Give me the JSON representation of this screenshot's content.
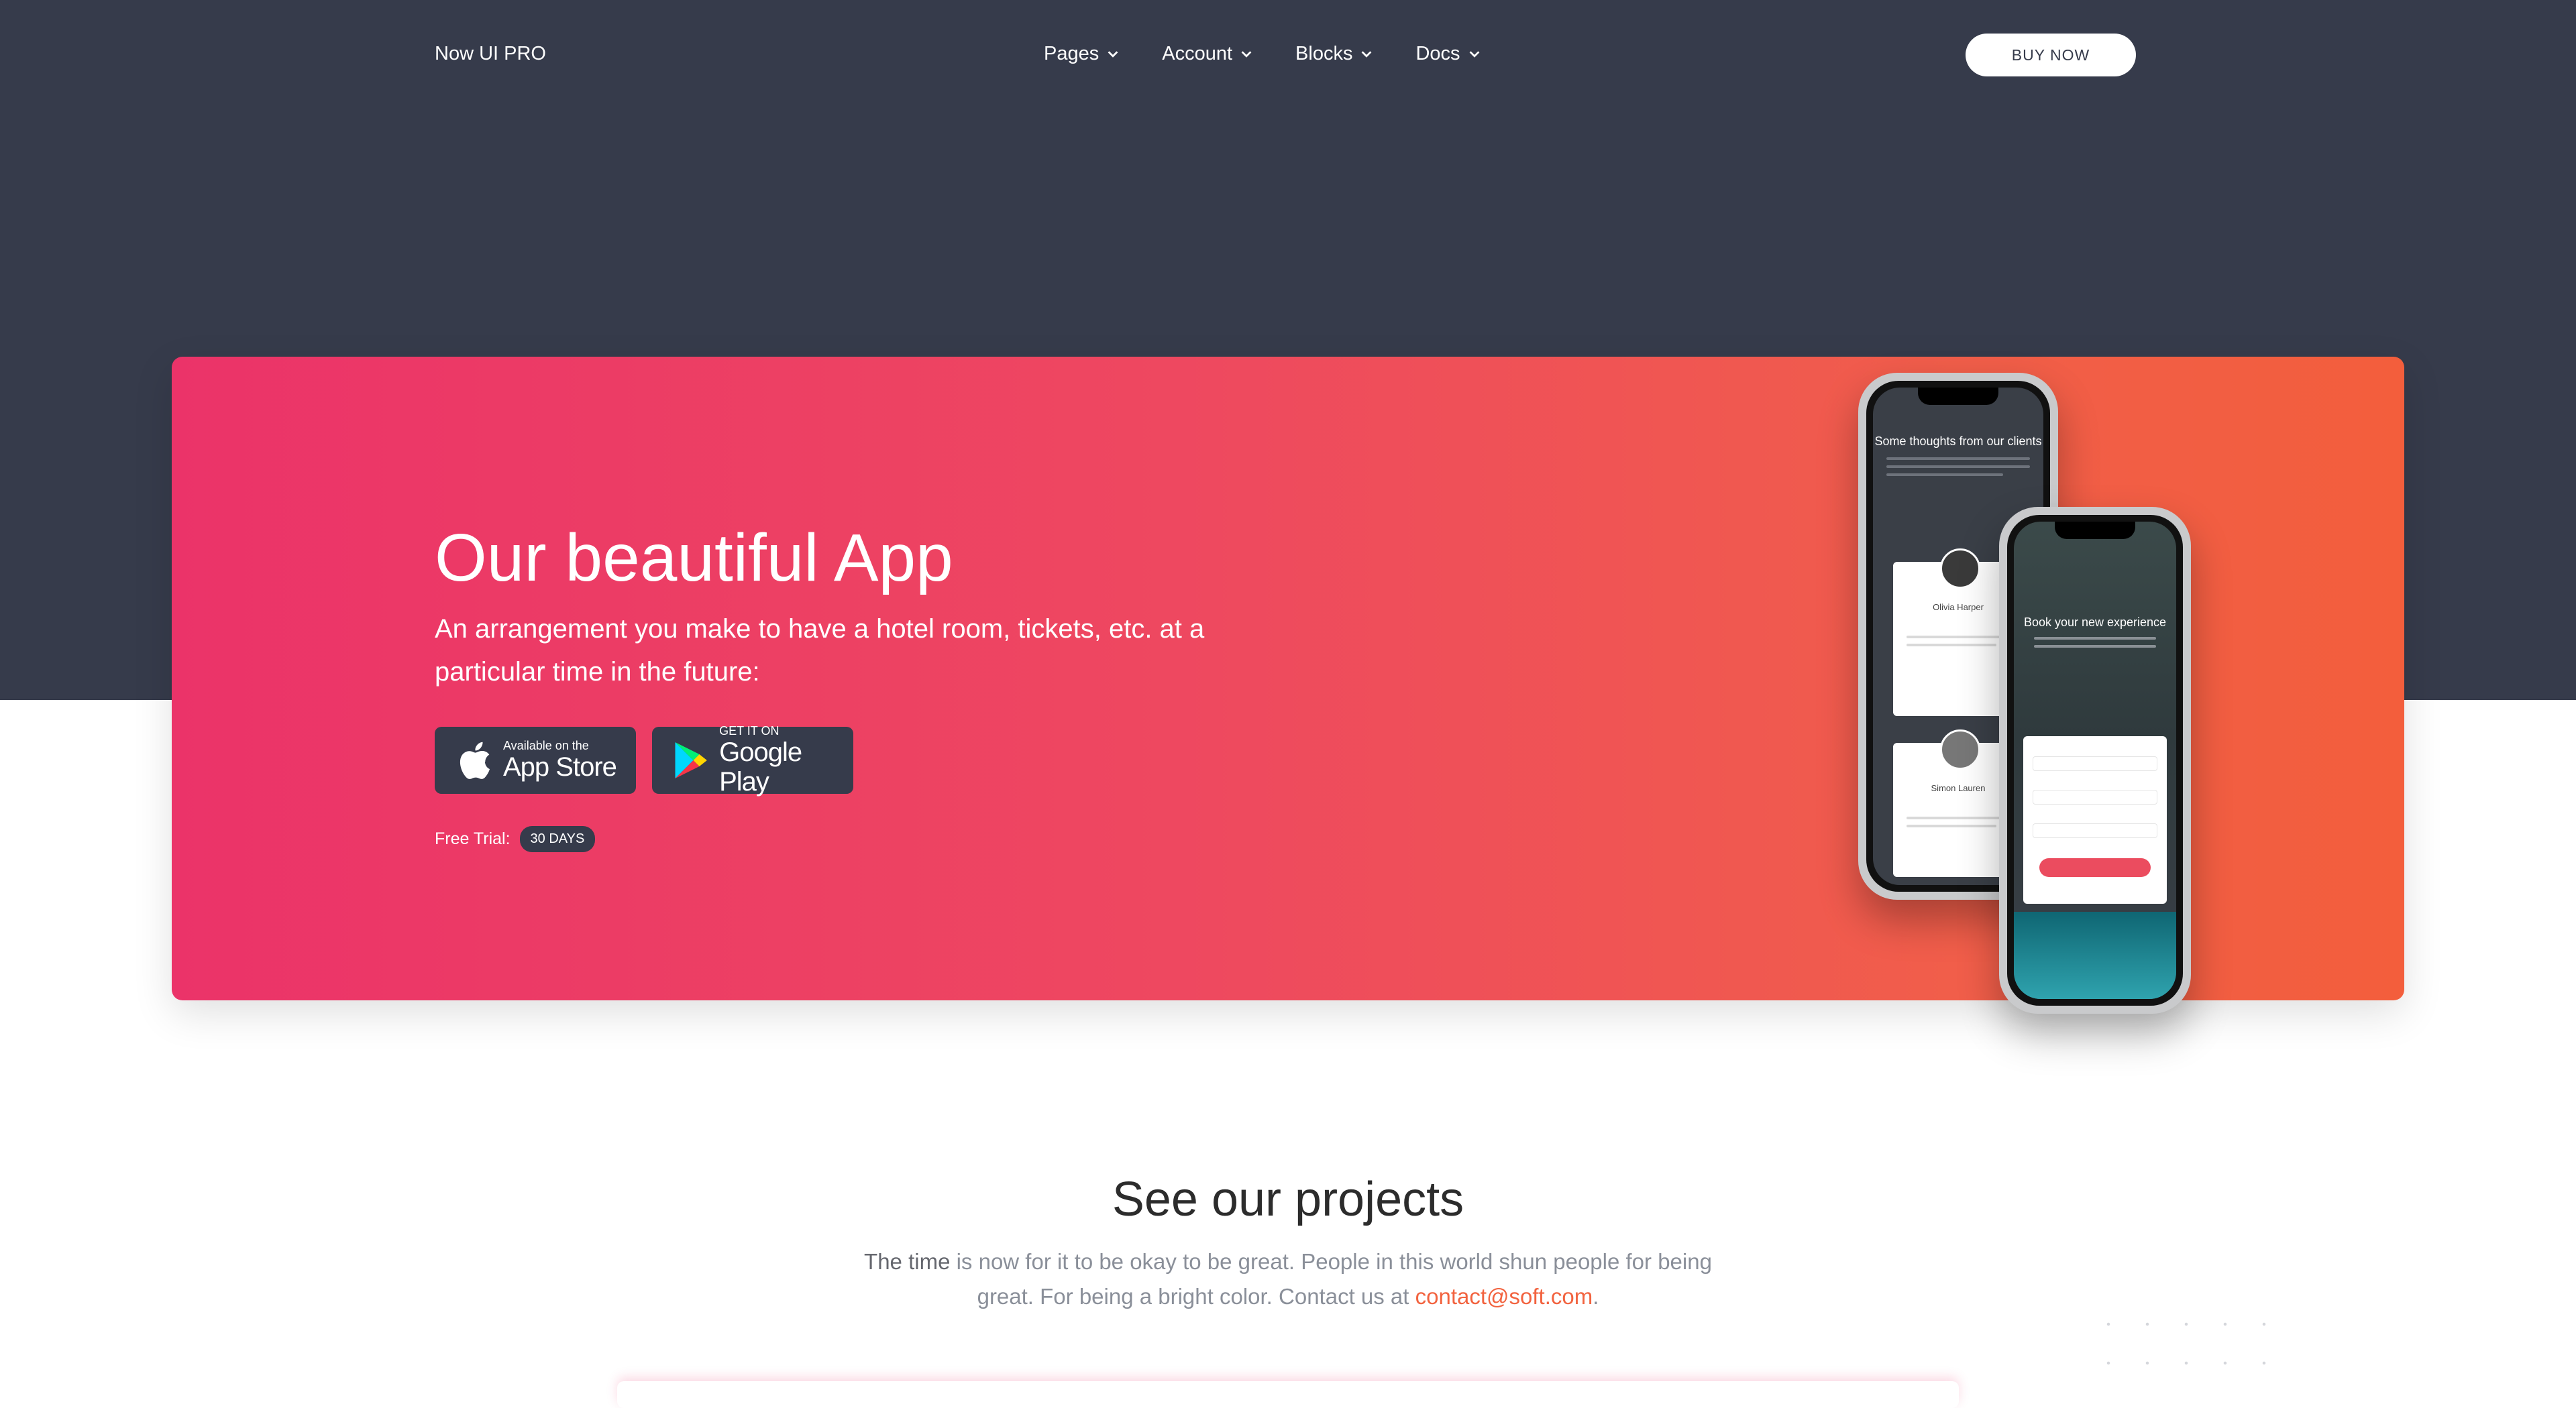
{
  "navbar": {
    "brand": "Now UI PRO",
    "items": [
      {
        "label": "Pages"
      },
      {
        "label": "Account"
      },
      {
        "label": "Blocks"
      },
      {
        "label": "Docs"
      }
    ],
    "cta": "BUY NOW"
  },
  "hero": {
    "title": "Our beautiful App",
    "subtitle": "An arrangement you make to have a hotel room, tickets, etc. at a particular time in the future:",
    "app_store": {
      "small": "Available on the",
      "big": "App Store"
    },
    "google_play": {
      "small": "GET IT ON",
      "big": "Google Play"
    },
    "trial_label": "Free Trial:",
    "trial_badge": "30 DAYS",
    "phone_back": {
      "title": "Some thoughts from our clients",
      "person1": "Olivia Harper",
      "person2": "Simon Lauren"
    },
    "phone_front": {
      "title": "Book your new experience"
    }
  },
  "projects": {
    "title": "See our projects",
    "text_strong": "The time",
    "text_body": " is now for it to be okay to be great. People in this world shun people for being great. For being a bright color. Contact us at ",
    "email": "contact@soft.com",
    "text_end": "."
  },
  "colors": {
    "dark": "#363b4b",
    "gradient_start": "#eb3369",
    "gradient_end": "#f35e3c",
    "link": "#f2633f"
  },
  "icons": [
    "chevron-down-icon",
    "apple-icon",
    "google-play-icon"
  ]
}
